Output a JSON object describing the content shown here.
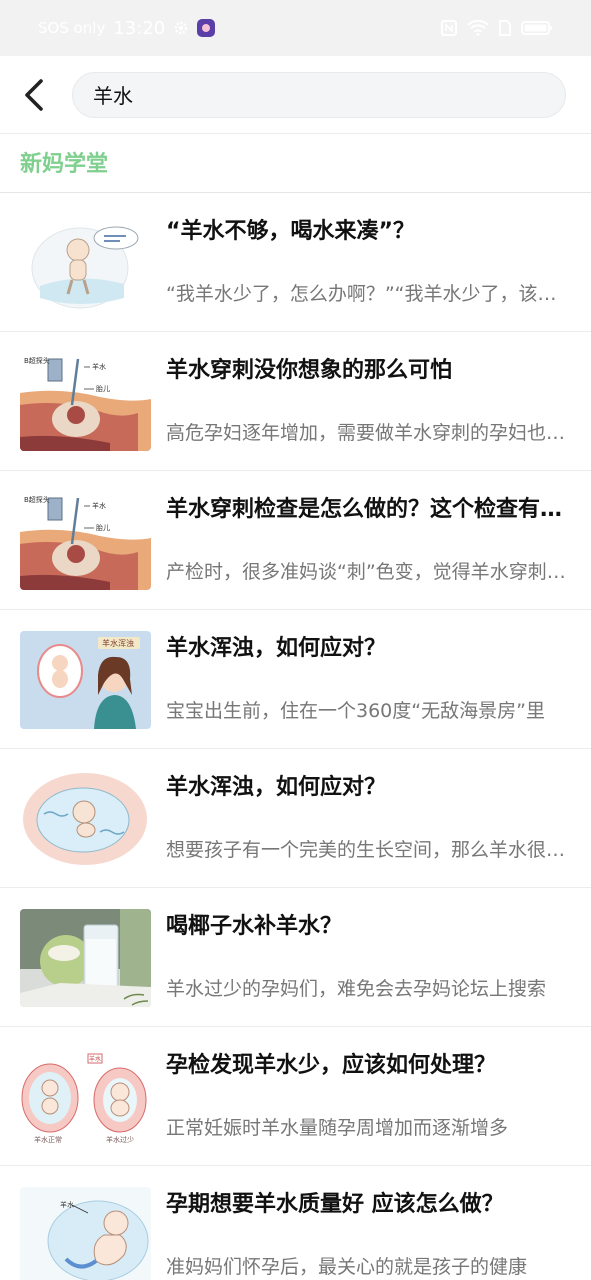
{
  "status_bar": {
    "carrier": "SOS only",
    "time": "13:20",
    "icons": [
      "gear-icon",
      "app-icon",
      "nfc-icon",
      "wifi-icon",
      "sim-icon",
      "battery-icon"
    ]
  },
  "search": {
    "query": "羊水",
    "back_icon": "chevron-left-icon"
  },
  "section": {
    "title": "新妈学堂",
    "accent_color": "#7fcf8e"
  },
  "articles": [
    {
      "title": "“羊水不够，喝水来凑”？",
      "summary": "“我羊水少了，怎么办啊？”“我羊水少了，该怎么办？”",
      "thumb": "baby-in-womb-cartoon"
    },
    {
      "title": "羊水穿刺没你想象的那么可怕",
      "summary": "高危孕妇逐年增加，需要做羊水穿刺的孕妇也越来越多",
      "thumb": "amniocentesis-diagram",
      "thumb_text": [
        "B超探头",
        "羊水",
        "胎儿"
      ]
    },
    {
      "title": "羊水穿刺检查是怎么做的？这个检查有什么风险？",
      "summary": "产检时，很多准妈谈“刺”色变，觉得羊水穿刺很可怕",
      "thumb": "amniocentesis-diagram",
      "thumb_text": [
        "B超探头",
        "羊水",
        "胎儿"
      ]
    },
    {
      "title": "羊水浑浊，如何应对？",
      "summary": "宝宝出生前，住在一个360度“无敌海景房”里",
      "thumb": "mother-and-baby-cartoon",
      "thumb_text": [
        "羊水浑浊"
      ]
    },
    {
      "title": "羊水浑浊，如何应对？",
      "summary": "想要孩子有一个完美的生长空间，那么羊水很重要",
      "thumb": "baby-swimming-cartoon"
    },
    {
      "title": "喝椰子水补羊水？",
      "summary": "羊水过少的孕妈们，难免会去孕妈论坛上搜索",
      "thumb": "coconut-water-photo"
    },
    {
      "title": "孕检发现羊水少，应该如何处理？",
      "summary": "正常妊娠时羊水量随孕周增加而逐渐增多",
      "thumb": "amniotic-level-diagram",
      "thumb_text": [
        "羊水",
        "羊水正常",
        "羊水过少"
      ]
    },
    {
      "title": "孕期想要羊水质量好 应该怎么做？",
      "summary": "准妈妈们怀孕后，最关心的就是孩子的健康",
      "thumb": "fetus-in-bubble-cartoon",
      "thumb_text": [
        "羊水"
      ]
    }
  ]
}
